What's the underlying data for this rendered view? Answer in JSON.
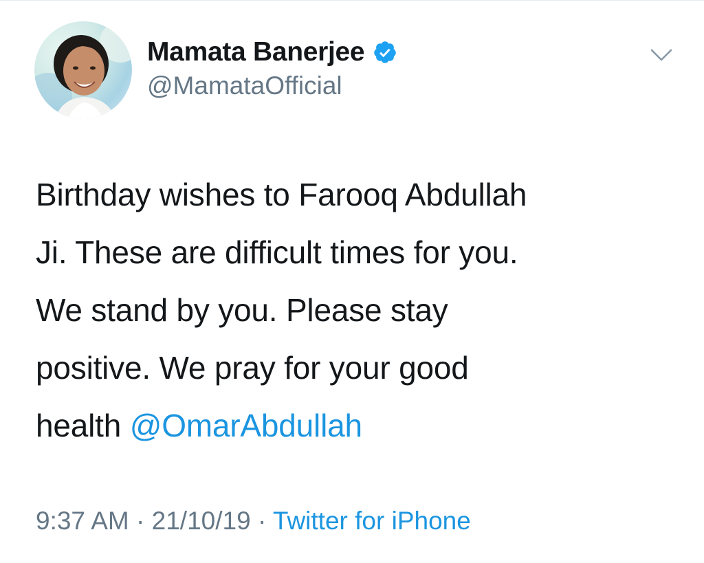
{
  "user": {
    "display_name": "Mamata Banerjee",
    "handle": "@MamataOfficial",
    "verified": true,
    "avatar_icon": "profile-photo"
  },
  "tweet": {
    "lines": [
      "Birthday wishes to Farooq Abdullah",
      "Ji. These are difficult times for you.",
      "We stand by you. Please stay",
      "positive. We pray for your good"
    ],
    "last_line_prefix": "health ",
    "mention": "@OmarAbdullah"
  },
  "meta": {
    "time": "9:37 AM",
    "separator": " · ",
    "date": "21/10/19",
    "separator2": " · ",
    "source": "Twitter for iPhone"
  },
  "colors": {
    "link": "#1b95e0",
    "secondary": "#657786",
    "text": "#14171a",
    "verified": "#1da1f2"
  },
  "icons": {
    "menu": "chevron-down-icon",
    "verified": "verified-badge-icon"
  }
}
